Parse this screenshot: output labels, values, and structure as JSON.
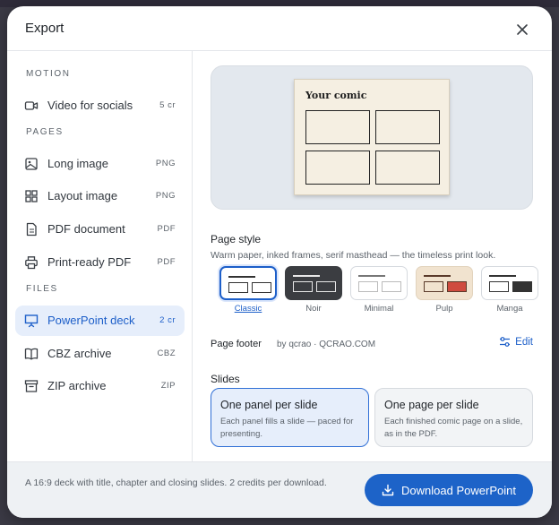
{
  "dialog": {
    "title": "Export"
  },
  "sidebar": {
    "sections": [
      {
        "label": "MOTION"
      },
      {
        "label": "PAGES"
      },
      {
        "label": "FILES"
      }
    ],
    "items": [
      {
        "label": "Video for socials",
        "tag": "5 cr",
        "icon": "video-icon"
      },
      {
        "label": "Long image",
        "tag": "PNG",
        "icon": "image-icon"
      },
      {
        "label": "Layout image",
        "tag": "PNG",
        "icon": "grid-icon"
      },
      {
        "label": "PDF document",
        "tag": "PDF",
        "icon": "document-icon"
      },
      {
        "label": "Print-ready PDF",
        "tag": "PDF",
        "icon": "printer-icon"
      },
      {
        "label": "PowerPoint deck",
        "tag": "2 cr",
        "icon": "presentation-icon",
        "active": true
      },
      {
        "label": "CBZ archive",
        "tag": "CBZ",
        "icon": "book-icon"
      },
      {
        "label": "ZIP archive",
        "tag": "ZIP",
        "icon": "archive-icon"
      }
    ]
  },
  "preview": {
    "masthead": "Your comic"
  },
  "page_style": {
    "title": "Page style",
    "description": "Warm paper, inked frames, serif masthead — the timeless print look.",
    "options": [
      {
        "name": "Classic",
        "selected": true
      },
      {
        "name": "Noir"
      },
      {
        "name": "Minimal"
      },
      {
        "name": "Pulp"
      },
      {
        "name": "Manga"
      }
    ]
  },
  "page_footer": {
    "title": "Page footer",
    "value": "by qcrao · QCRAO.COM",
    "edit_label": "Edit"
  },
  "slides": {
    "title": "Slides",
    "options": [
      {
        "title": "One panel per slide",
        "description": "Each panel fills a slide — paced for presenting.",
        "selected": true
      },
      {
        "title": "One page per slide",
        "description": "Each finished comic page on a slide, as in the PDF."
      }
    ]
  },
  "footer": {
    "note": "A 16:9 deck with title, chapter and closing slides. 2 credits per download.",
    "button_label": "Download PowerPoint"
  },
  "colors": {
    "accent": "#1d63c8",
    "accent_bg": "#e6eefb",
    "paper": "#f5efe2"
  }
}
